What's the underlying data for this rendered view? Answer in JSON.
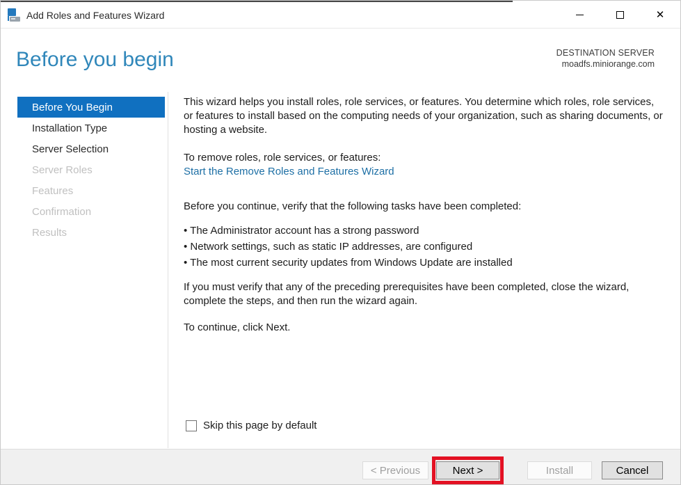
{
  "window": {
    "title": "Add Roles and Features Wizard"
  },
  "header": {
    "title": "Before you begin",
    "destination_label": "DESTINATION SERVER",
    "destination_server": "moadfs.miniorange.com"
  },
  "sidebar": {
    "items": [
      {
        "label": "Before You Begin",
        "state": "selected"
      },
      {
        "label": "Installation Type",
        "state": "enabled"
      },
      {
        "label": "Server Selection",
        "state": "enabled"
      },
      {
        "label": "Server Roles",
        "state": "disabled"
      },
      {
        "label": "Features",
        "state": "disabled"
      },
      {
        "label": "Confirmation",
        "state": "disabled"
      },
      {
        "label": "Results",
        "state": "disabled"
      }
    ]
  },
  "content": {
    "intro": "This wizard helps you install roles, role services, or features. You determine which roles, role services, or features to install based on the computing needs of your organization, such as sharing documents, or hosting a website.",
    "remove_heading": "To remove roles, role services, or features:",
    "remove_link": "Start the Remove Roles and Features Wizard",
    "verify_heading": "Before you continue, verify that the following tasks have been completed:",
    "bullets": [
      "The Administrator account has a strong password",
      "Network settings, such as static IP addresses, are configured",
      "The most current security updates from Windows Update are installed"
    ],
    "note": "If you must verify that any of the preceding prerequisites have been completed, close the wizard, complete the steps, and then run the wizard again.",
    "continue_text": "To continue, click Next.",
    "skip_checkbox_label": "Skip this page by default",
    "skip_checked": false
  },
  "footer": {
    "previous_label": "< Previous",
    "next_label": "Next >",
    "install_label": "Install",
    "cancel_label": "Cancel"
  },
  "colors": {
    "accent_blue": "#1070c0",
    "heading_blue": "#3087ba",
    "link_blue": "#1d6fa5",
    "annotation_red": "#e31123",
    "footer_gray": "#f0f0f0"
  }
}
